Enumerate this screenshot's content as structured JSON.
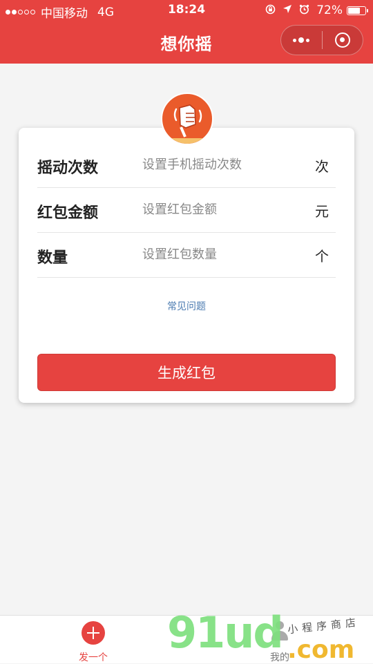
{
  "status_bar": {
    "carrier": "中国移动",
    "network": "4G",
    "time": "18:24",
    "battery_text": "72%",
    "battery_level": 0.72,
    "signal_dots": [
      true,
      true,
      false,
      false,
      false
    ],
    "icons": [
      "rotation-lock-icon",
      "location-arrow-icon",
      "alarm-clock-icon",
      "battery-icon"
    ]
  },
  "nav": {
    "title": "想你摇",
    "capsule_icons": [
      "more-dots-icon",
      "close-target-icon"
    ]
  },
  "form": {
    "logo_icon": "shaking-hand-icon",
    "rows": [
      {
        "label": "摇动次数",
        "placeholder": "设置手机摇动次数",
        "value": "",
        "unit": "次"
      },
      {
        "label": "红包金额",
        "placeholder": "设置红包金额",
        "value": "",
        "unit": "元"
      },
      {
        "label": "数量",
        "placeholder": "设置红包数量",
        "value": "",
        "unit": "个"
      }
    ],
    "faq_link": "常见问题",
    "submit_label": "生成红包"
  },
  "tab_bar": {
    "items": [
      {
        "label": "发一个",
        "icon": "add-circle-icon",
        "active": true
      },
      {
        "label": "我的",
        "icon": "user-icon",
        "active": false
      }
    ]
  },
  "watermark": {
    "brand": "91ud",
    "tld": ".com",
    "cn": "小程序商店"
  },
  "colors": {
    "accent": "#e64340",
    "background": "#f4f4f4",
    "link": "#4a7ab0",
    "logo": "#ea5b2b"
  }
}
